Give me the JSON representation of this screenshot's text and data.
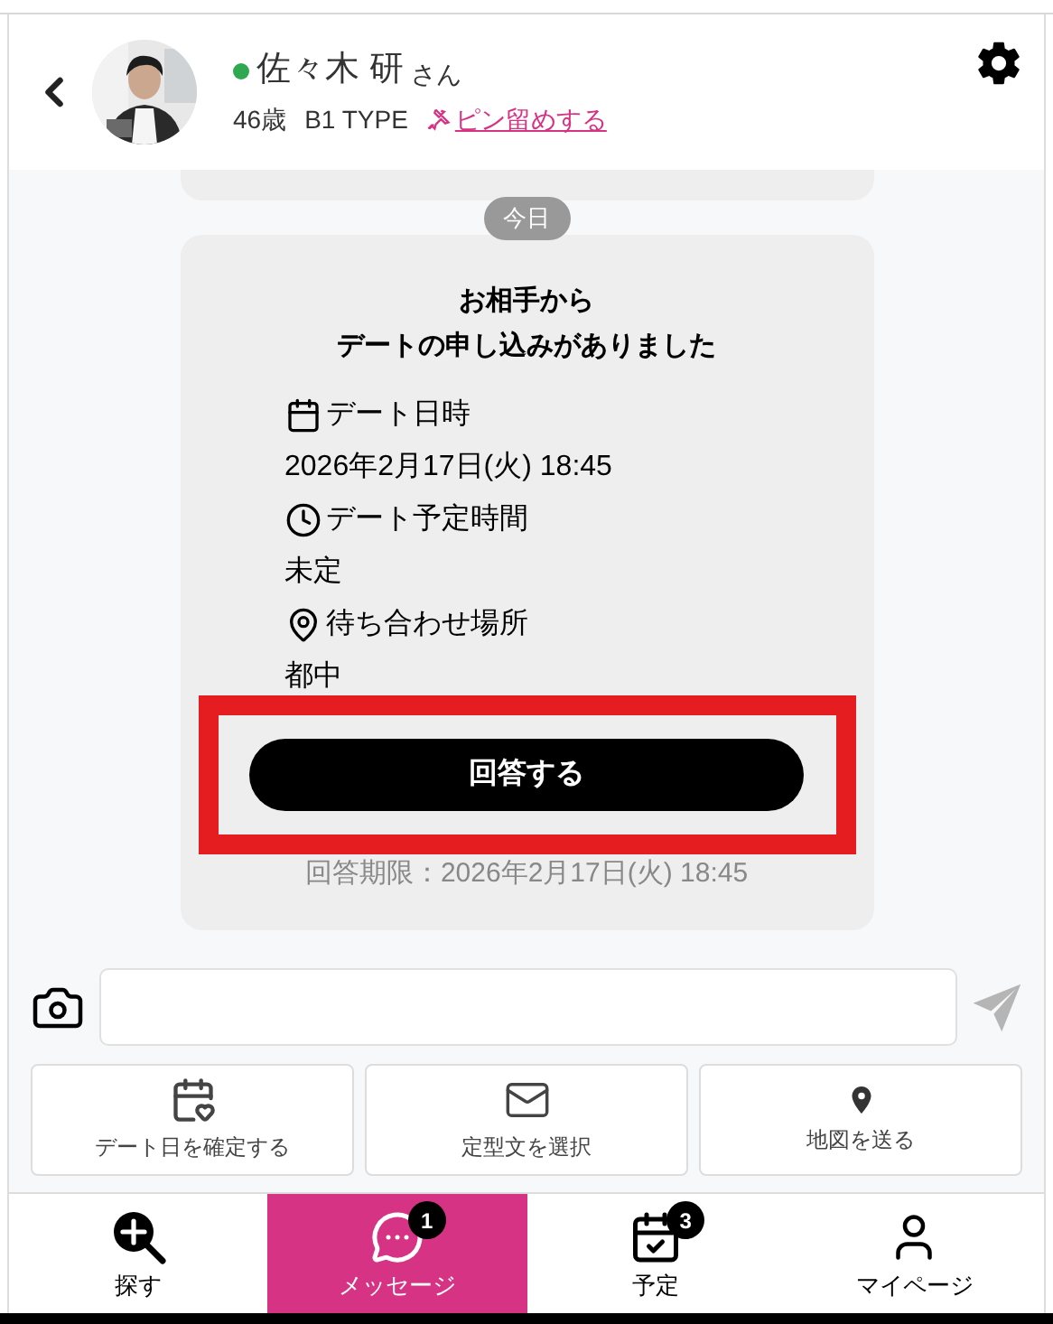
{
  "header": {
    "name": "佐々木 研",
    "honorific": "さん",
    "online": true,
    "age": "46歳",
    "type": "B1 TYPE",
    "pin_link": "ピン留めする"
  },
  "day_label": "今日",
  "card": {
    "title_lines": [
      "お相手から",
      "デートの申し込みがありました"
    ],
    "items": [
      {
        "kind": "calendar",
        "label": "デート日時",
        "value": "2026年2月17日(火) 18:45"
      },
      {
        "kind": "clock",
        "label": "デート予定時間",
        "value": "未定"
      },
      {
        "kind": "pin",
        "label": "待ち合わせ場所",
        "value": "都中"
      }
    ],
    "button": "回答する",
    "deadline": "回答期限：2026年2月17日(火) 18:45"
  },
  "actions": [
    {
      "kind": "calendar",
      "label": "デート日を確定する"
    },
    {
      "kind": "mail",
      "label": "定型文を選択"
    },
    {
      "kind": "pin",
      "label": "地図を送る"
    }
  ],
  "nav": [
    {
      "kind": "search",
      "label": "探す",
      "selected": false
    },
    {
      "kind": "message",
      "label": "メッセージ",
      "selected": true,
      "badge": "1"
    },
    {
      "kind": "schedule",
      "label": "予定",
      "selected": false,
      "badge": "3"
    },
    {
      "kind": "user",
      "label": "マイページ",
      "selected": false
    }
  ]
}
